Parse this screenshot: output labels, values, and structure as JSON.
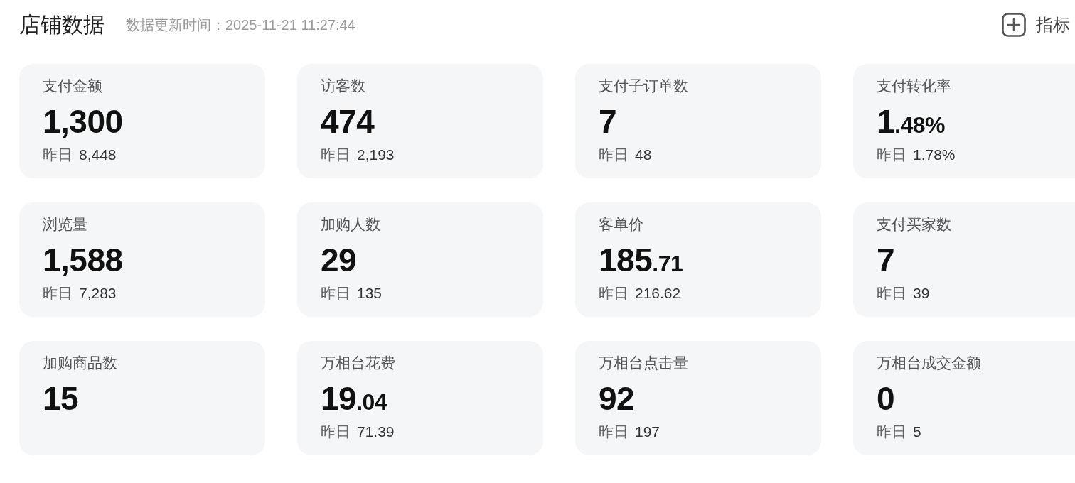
{
  "header": {
    "title": "店铺数据",
    "update_time": "数据更新时间：2025-11-21 11:27:44",
    "metrics_button": "指标"
  },
  "cards": [
    {
      "label": "支付金额",
      "value": "1,300",
      "yesterday_label": "昨日",
      "yesterday_value": "8,448"
    },
    {
      "label": "访客数",
      "value": "474",
      "yesterday_label": "昨日",
      "yesterday_value": "2,193"
    },
    {
      "label": "支付子订单数",
      "value": "7",
      "yesterday_label": "昨日",
      "yesterday_value": "48"
    },
    {
      "label": "支付转化率",
      "value": "1",
      "value_fraction": ".48%",
      "yesterday_label": "昨日",
      "yesterday_value": "1.78%"
    },
    {
      "label": "浏览量",
      "value": "1,588",
      "yesterday_label": "昨日",
      "yesterday_value": "7,283"
    },
    {
      "label": "加购人数",
      "value": "29",
      "yesterday_label": "昨日",
      "yesterday_value": "135"
    },
    {
      "label": "客单价",
      "value": "185",
      "value_fraction": ".71",
      "yesterday_label": "昨日",
      "yesterday_value": "216.62"
    },
    {
      "label": "支付买家数",
      "value": "7",
      "yesterday_label": "昨日",
      "yesterday_value": "39"
    },
    {
      "label": "加购商品数",
      "value": "15"
    },
    {
      "label": "万相台花费",
      "value": "19",
      "value_fraction": ".04",
      "yesterday_label": "昨日",
      "yesterday_value": "71.39"
    },
    {
      "label": "万相台点击量",
      "value": "92",
      "yesterday_label": "昨日",
      "yesterday_value": "197"
    },
    {
      "label": "万相台成交金额",
      "value": "0",
      "yesterday_label": "昨日",
      "yesterday_value": "5"
    }
  ]
}
